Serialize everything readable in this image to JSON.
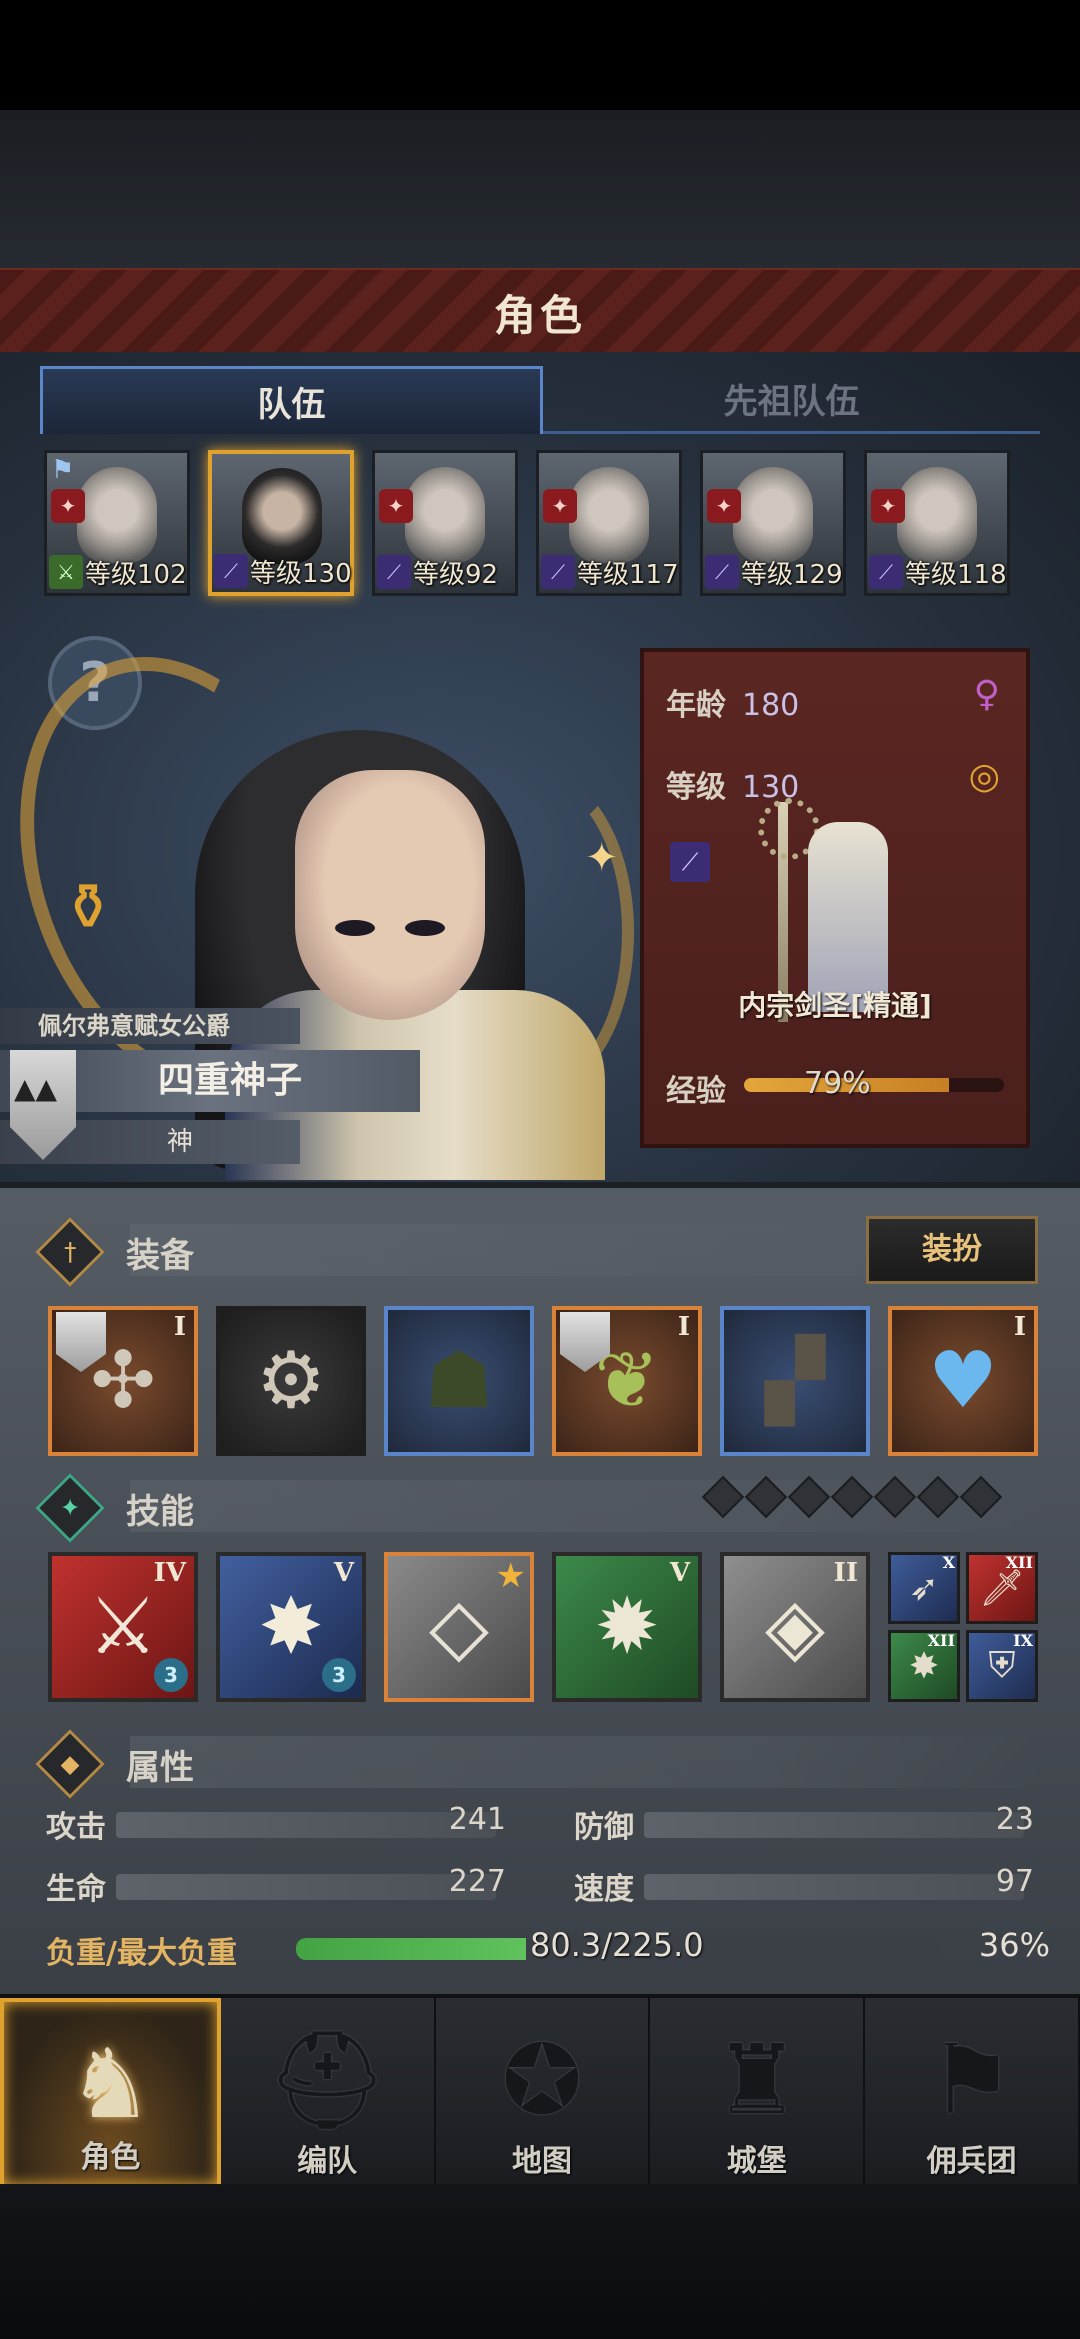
{
  "title": "角色",
  "tabs": [
    {
      "label": "队伍",
      "active": true
    },
    {
      "label": "先祖队伍",
      "active": false
    }
  ],
  "roster": [
    {
      "level_text": "等级102",
      "weapon": "sword-icon",
      "selected": false
    },
    {
      "level_text": "等级130",
      "weapon": "staff-icon",
      "selected": true
    },
    {
      "level_text": "等级92",
      "weapon": "staff-icon",
      "selected": false
    },
    {
      "level_text": "等级117",
      "weapon": "staff-icon",
      "selected": false
    },
    {
      "level_text": "等级129",
      "weapon": "staff-icon",
      "selected": false
    },
    {
      "level_text": "等级118",
      "weapon": "staff-icon",
      "selected": false
    }
  ],
  "help_icon": "?",
  "character": {
    "title": "佩尔弗意赋女公爵",
    "name": "四重神子",
    "rank": "神"
  },
  "info": {
    "age_label": "年龄",
    "age": "180",
    "level_label": "等级",
    "level": "130",
    "class_name": "内宗剑圣[精通]",
    "xp_label": "经验",
    "xp_text": "79%",
    "xp_fraction": 0.79,
    "gender_symbol": "♀",
    "ring_symbol": "◎"
  },
  "sections": {
    "equipment": "装备",
    "skills": "技能",
    "attributes": "属性"
  },
  "dress_button": "装扮",
  "equipment": [
    {
      "icon": "crossed-blades-icon",
      "rarity": "orange",
      "rank": "I",
      "shield": true
    },
    {
      "icon": "sawblade-icon",
      "rarity": "none",
      "rank": "",
      "shield": false
    },
    {
      "icon": "hood-icon",
      "rarity": "blue",
      "rank": "",
      "shield": false
    },
    {
      "icon": "armor-icon",
      "rarity": "orange",
      "rank": "I",
      "shield": true
    },
    {
      "icon": "boots-icon",
      "rarity": "blue",
      "rank": "",
      "shield": false
    },
    {
      "icon": "heart-amulet-icon",
      "rarity": "orange",
      "rank": "I",
      "shield": false
    }
  ],
  "skills": [
    {
      "rank": "IV",
      "count": "3"
    },
    {
      "rank": "V",
      "count": "3"
    },
    {
      "rank": "",
      "count": ""
    },
    {
      "rank": "V",
      "count": ""
    },
    {
      "rank": "II",
      "count": ""
    }
  ],
  "mini_skills": [
    {
      "rank": "X"
    },
    {
      "rank": "XII"
    },
    {
      "rank": "XII"
    },
    {
      "rank": "IX"
    }
  ],
  "skill_slots_empty": 7,
  "stats": [
    {
      "label": "攻击",
      "value": "241"
    },
    {
      "label": "防御",
      "value": "23"
    },
    {
      "label": "生命",
      "value": "227"
    },
    {
      "label": "速度",
      "value": "97"
    }
  ],
  "load": {
    "label": "负重/最大负重",
    "value_text": "80.3/225.0",
    "percent_text": "36%",
    "fraction": 0.357
  },
  "nav": [
    {
      "label": "角色",
      "icon": "knight-icon",
      "active": true
    },
    {
      "label": "编队",
      "icon": "helmet-icon",
      "active": false
    },
    {
      "label": "地图",
      "icon": "compass-icon",
      "active": false
    },
    {
      "label": "城堡",
      "icon": "castle-icon",
      "active": false
    },
    {
      "label": "佣兵团",
      "icon": "mercenary-icon",
      "active": false
    }
  ],
  "colors": {
    "accent_gold": "#e0a22f",
    "title_red": "#5a211d",
    "tab_blue": "#5b86c9",
    "load_green": "#4fb04d"
  }
}
